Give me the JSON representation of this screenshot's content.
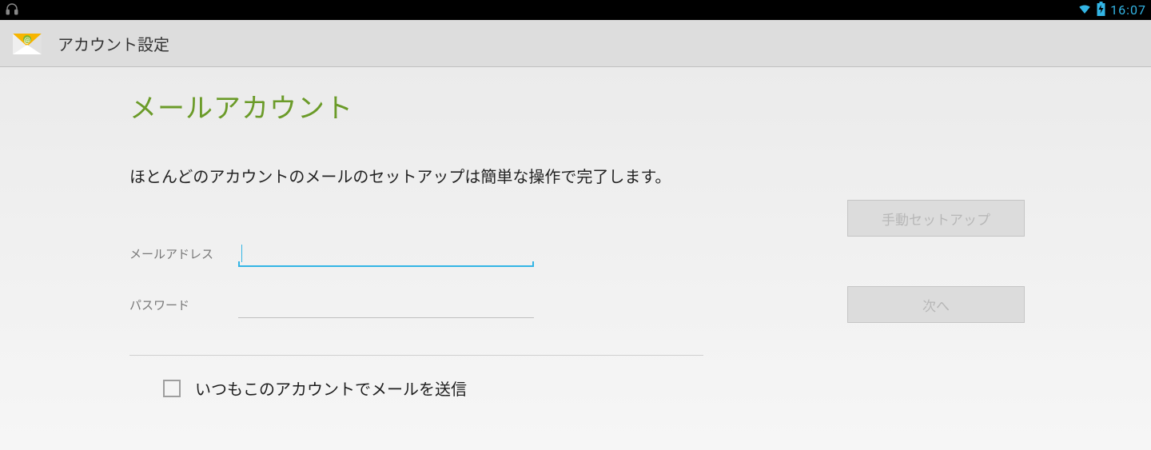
{
  "status_bar": {
    "time": "16:07"
  },
  "action_bar": {
    "title": "アカウント設定"
  },
  "page": {
    "title": "メールアカウント",
    "intro": "ほとんどのアカウントのメールのセットアップは簡単な操作で完了します。",
    "email_label": "メールアドレス",
    "password_label": "パスワード",
    "default_sender_label": "いつもこのアカウントでメールを送信"
  },
  "buttons": {
    "manual_setup": "手動セットアップ",
    "next": "次へ"
  },
  "form_values": {
    "email": "",
    "password": ""
  }
}
